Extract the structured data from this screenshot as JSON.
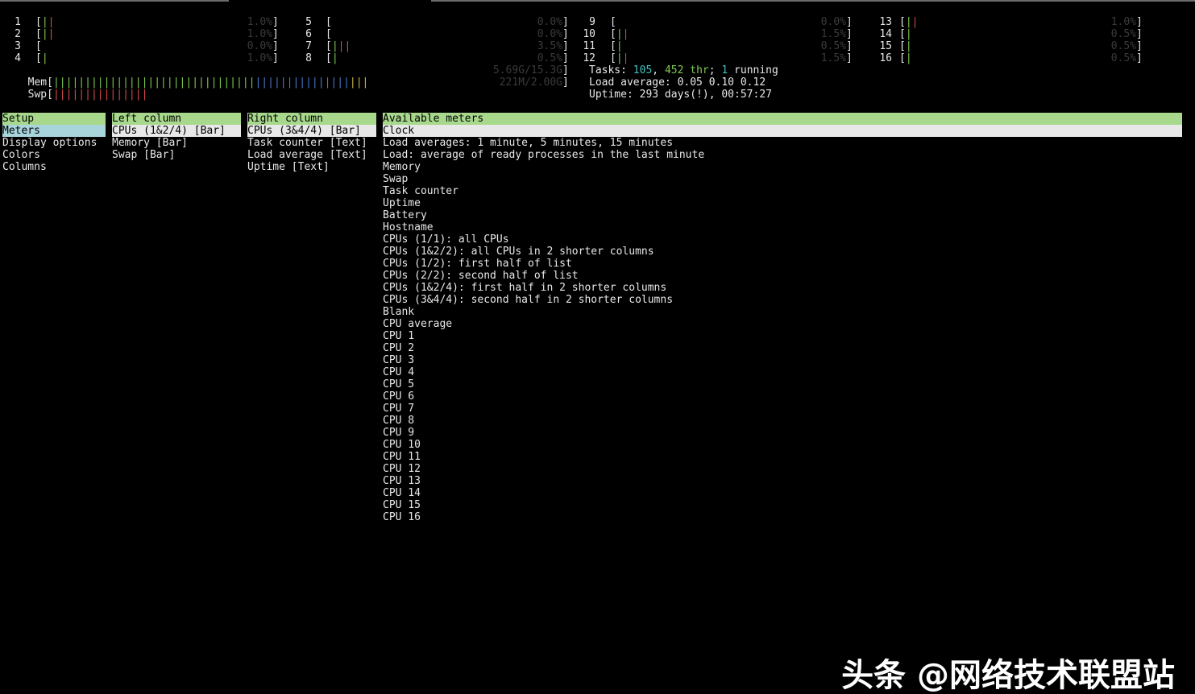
{
  "cpus": [
    {
      "num": "1",
      "bar": "||",
      "pct": "1.0%"
    },
    {
      "num": "2",
      "bar": "||",
      "pct": "1.0%"
    },
    {
      "num": "3",
      "bar": "",
      "pct": "0.0%"
    },
    {
      "num": "4",
      "bar": "|",
      "pct": "1.0%"
    },
    {
      "num": "5",
      "bar": "",
      "pct": "0.0%"
    },
    {
      "num": "6",
      "bar": "",
      "pct": "0.0%"
    },
    {
      "num": "7",
      "bar": "|||",
      "pct": "3.5%"
    },
    {
      "num": "8",
      "bar": "|",
      "pct": "0.5%"
    },
    {
      "num": "9",
      "bar": "",
      "pct": "0.0%"
    },
    {
      "num": "10",
      "bar": "||",
      "pct": "1.5%"
    },
    {
      "num": "11",
      "bar": "|",
      "pct": "0.5%"
    },
    {
      "num": "12",
      "bar": "||",
      "pct": "1.5%"
    },
    {
      "num": "13",
      "bar": "||",
      "pct": "1.0%"
    },
    {
      "num": "14",
      "bar": "|",
      "pct": "0.5%"
    },
    {
      "num": "15",
      "bar": "|",
      "pct": "0.5%"
    },
    {
      "num": "16",
      "bar": "|",
      "pct": "0.5%"
    }
  ],
  "mem": {
    "label": "Mem",
    "value": "5.69G/15.3G",
    "fraction": 0.37
  },
  "swp": {
    "label": "Swp",
    "value": "221M/2.00G",
    "fraction": 0.11
  },
  "tasks": {
    "prefix": "Tasks: ",
    "count": "105",
    "sep": ", ",
    "threads": "452 thr",
    "sep2": "; ",
    "running": "1",
    "suffix": " running"
  },
  "load_average": "Load average: 0.05 0.10 0.12",
  "uptime": "Uptime: 293 days(!), 00:57:27",
  "setup": {
    "header": "Setup",
    "items": [
      "Meters",
      "Display options",
      "Colors",
      "Columns"
    ]
  },
  "left_column": {
    "header": "Left column",
    "items": [
      "CPUs (1&2/4) [Bar]",
      "Memory [Bar]",
      "Swap [Bar]"
    ]
  },
  "right_column": {
    "header": "Right column",
    "items": [
      "CPUs (3&4/4) [Bar]",
      "Task counter [Text]",
      "Load average [Text]",
      "Uptime [Text]"
    ]
  },
  "available_meters": {
    "header": "Available meters",
    "items": [
      "Clock",
      "Load averages: 1 minute, 5 minutes, 15 minutes",
      "Load: average of ready processes in the last minute",
      "Memory",
      "Swap",
      "Task counter",
      "Uptime",
      "Battery",
      "Hostname",
      "CPUs (1/1): all CPUs",
      "CPUs (1&2/2): all CPUs in 2 shorter columns",
      "CPUs (1/2): first half of list",
      "CPUs (2/2): second half of list",
      "CPUs (1&2/4): first half in 2 shorter columns",
      "CPUs (3&4/4): second half in 2 shorter columns",
      "Blank",
      "CPU average",
      "CPU 1",
      "CPU 2",
      "CPU 3",
      "CPU 4",
      "CPU 5",
      "CPU 6",
      "CPU 7",
      "CPU 8",
      "CPU 9",
      "CPU 10",
      "CPU 11",
      "CPU 12",
      "CPU 13",
      "CPU 14",
      "CPU 15",
      "CPU 16"
    ]
  },
  "watermark": "头条 @网络技术联盟站",
  "colors": {
    "panel_header": "#a8d88c",
    "selected_setup": "#a8d4dc",
    "selected_item": "#e8e8e8"
  }
}
